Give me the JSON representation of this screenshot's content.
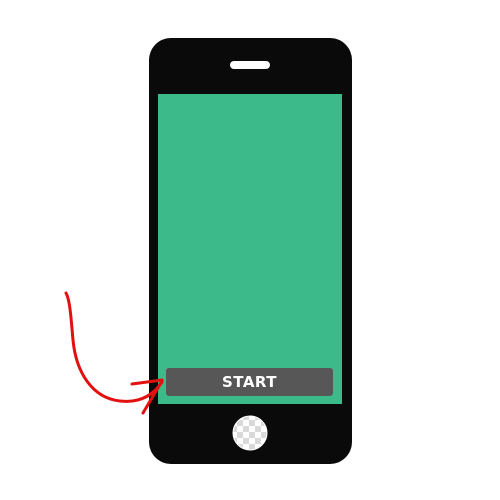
{
  "device": {
    "type": "smartphone",
    "body_color": "#0a0a0a",
    "screen_color": "#3dba8a"
  },
  "screen": {
    "start_button": {
      "label": "START",
      "background_color": "#575757",
      "text_color": "#ffffff"
    }
  },
  "annotation": {
    "icon": "hand-drawn-arrow-icon",
    "color": "#e31010",
    "points_to": "start-button"
  },
  "home_button": {
    "icon": "checkered-home-button-icon"
  }
}
